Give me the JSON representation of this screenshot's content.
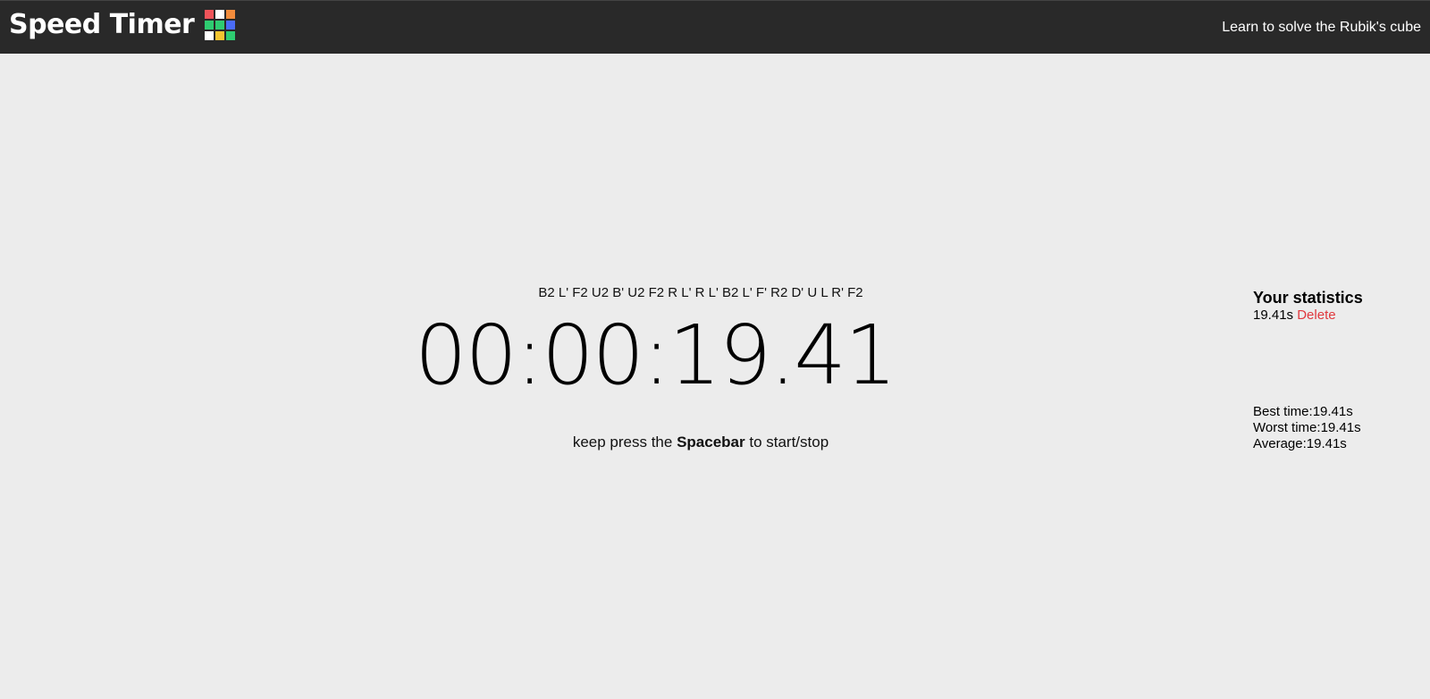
{
  "header": {
    "title": "Speed Timer",
    "logo_colors": [
      "#f0545a",
      "#ffffff",
      "#f28c3c",
      "#2ecc71",
      "#2ecc71",
      "#4a6cf7",
      "#ffffff",
      "#f4c430",
      "#2ecc71"
    ],
    "learn_link": "Learn to solve the Rubik's cube"
  },
  "main": {
    "scramble": "B2 L' F2 U2 B' U2 F2 R L' R L' B2 L' F' R2 D' U L R' F2",
    "timer": "00:00:19.41",
    "hint_prefix": "keep press the",
    "hint_key": "Spacebar",
    "hint_suffix": "to start/stop"
  },
  "stats": {
    "title": "Your statistics",
    "solves": [
      {
        "time": "19.41s",
        "delete_label": "Delete"
      }
    ],
    "best_label": "Best time:",
    "best_value": "19.41s",
    "worst_label": "Worst time:",
    "worst_value": "19.41s",
    "average_label": "Average:",
    "average_value": "19.41s"
  },
  "colors": {
    "topbar": "#292929",
    "background": "#ececec",
    "delete": "#e0393e"
  }
}
